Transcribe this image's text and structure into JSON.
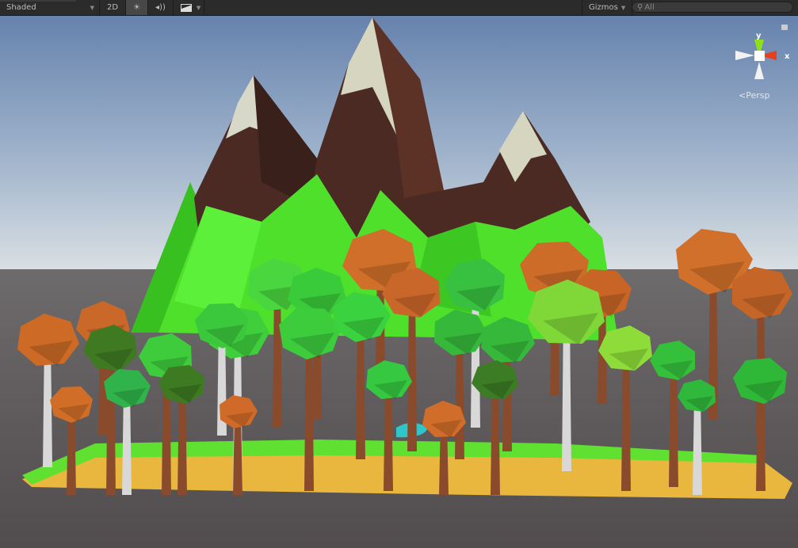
{
  "toolbar": {
    "draw_mode": "Shaded",
    "mode_2d": "2D",
    "lighting_icon": "sun-icon",
    "audio_icon": "speaker-icon",
    "effects_icon": "image-icon",
    "gizmos": "Gizmos",
    "search_placeholder": "All"
  },
  "gizmo": {
    "y_label": "y",
    "x_label": "x",
    "projection": "Persp",
    "colors": {
      "x": "#e8401c",
      "y": "#8ee01c"
    }
  }
}
